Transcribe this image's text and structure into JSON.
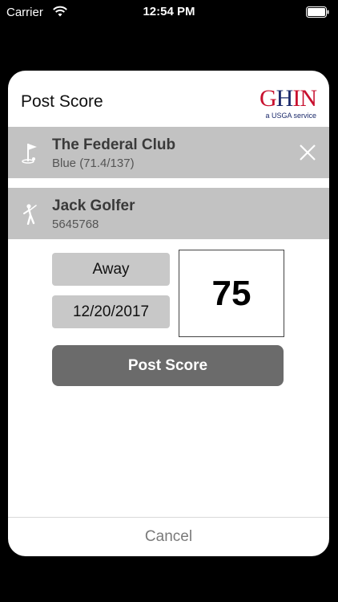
{
  "status_bar": {
    "carrier": "Carrier",
    "time": "12:54 PM"
  },
  "dialog": {
    "title": "Post Score",
    "logo": {
      "wordmark": "GHIN",
      "tagline": "a USGA service"
    },
    "course": {
      "name": "The Federal Club",
      "tees": "Blue (71.4/137)"
    },
    "player": {
      "name": "Jack Golfer",
      "ghin_number": "5645768"
    },
    "score_type": "Away",
    "date": "12/20/2017",
    "score": "75",
    "post_button_label": "Post Score",
    "cancel_label": "Cancel"
  },
  "icons": {
    "course": "golf-flag-icon",
    "player": "golfer-icon",
    "close": "close-icon",
    "wifi": "wifi-icon",
    "battery": "battery-icon"
  },
  "colors": {
    "row_bg": "#c2c2c2",
    "button_dark": "#6b6b6b",
    "logo_red": "#c8102e",
    "logo_navy": "#1b2a6b"
  }
}
